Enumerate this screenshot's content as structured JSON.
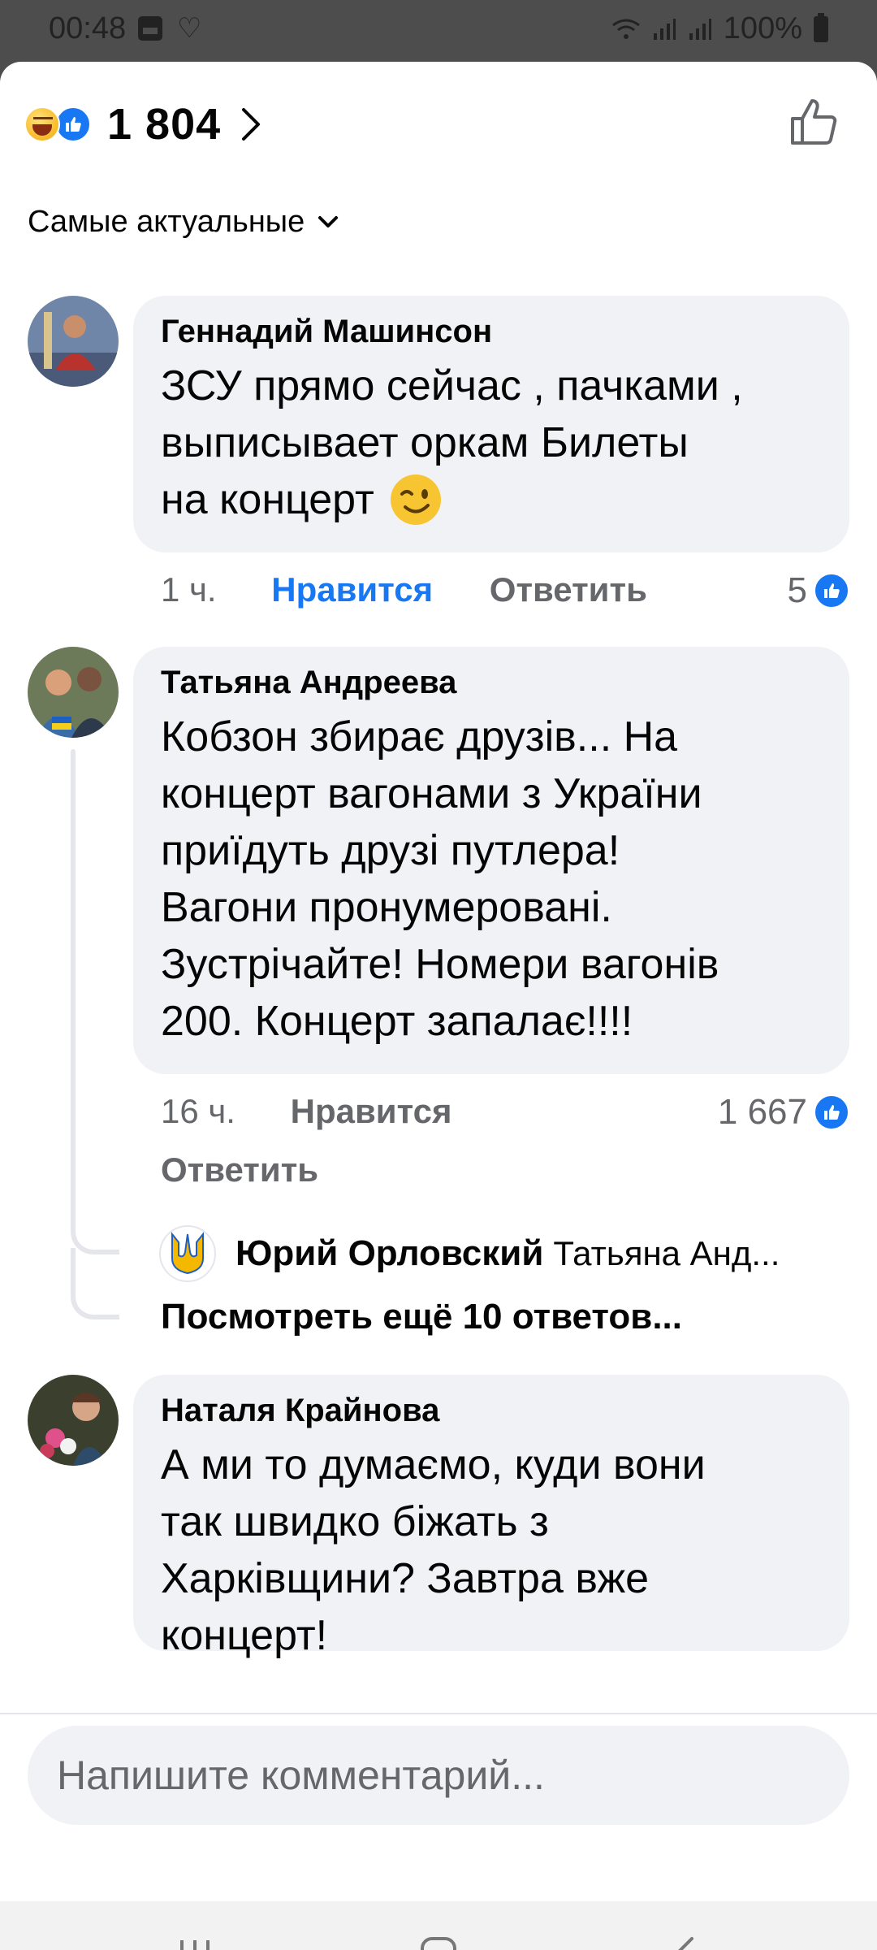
{
  "status_bar": {
    "time": "00:48",
    "battery": "100%"
  },
  "reactions": {
    "count": "1 804"
  },
  "sort": {
    "label": "Самые актуальные"
  },
  "comments": [
    {
      "author": "Геннадий Машинсон",
      "text_lines": [
        "ЗСУ прямо сейчас , пачками ,",
        "выписывает оркам Билеты",
        "на концерт"
      ],
      "time": "1 ч.",
      "like_label": "Нравится",
      "reply_label": "Ответить",
      "like_count": "5"
    },
    {
      "author": "Татьяна Андреева",
      "text_lines": [
        "Кобзон збирає друзів... На",
        "концерт вагонами з України",
        "приїдуть друзі путлера!",
        "Вагони пронумеровані.",
        "Зустрічайте! Номери вагонів",
        "200. Концерт запалає!!!!"
      ],
      "time": "16 ч.",
      "like_label": "Нравится",
      "reply_label": "Ответить",
      "like_count": "1 667",
      "reply_preview": {
        "author": "Юрий Орловский",
        "snippet": "Татьяна Анд..."
      },
      "more_replies": "Посмотреть ещё 10 ответов..."
    },
    {
      "author": "Наталя Крайнова",
      "text_lines": [
        "А ми то думаємо, куди вони",
        "так швидко біжать з",
        "Харківщини? Завтра вже",
        "концерт!"
      ]
    }
  ],
  "composer": {
    "placeholder": "Напишите комментарий..."
  },
  "colors": {
    "accent": "#1877f2",
    "bubble": "#f0f2f5",
    "muted": "#65676b"
  }
}
